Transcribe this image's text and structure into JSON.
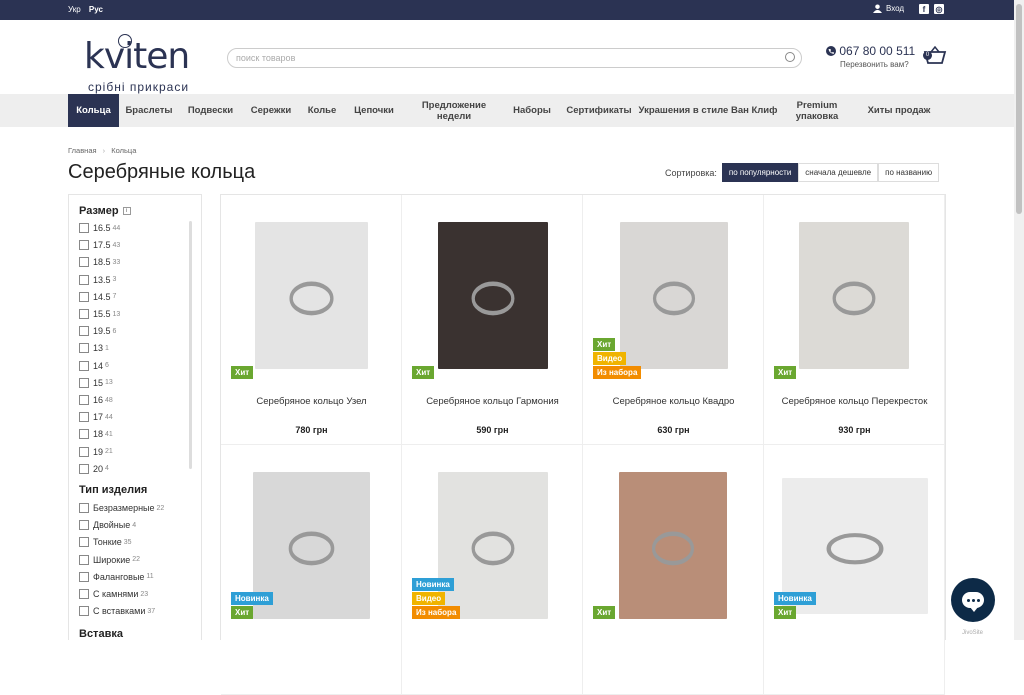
{
  "topbar": {
    "lang_ukr": "Укр",
    "lang_rus": "Рус",
    "login": "Вход",
    "social": [
      "facebook-icon",
      "instagram-icon"
    ]
  },
  "header": {
    "logo_word": "kviten",
    "logo_sub": "срібні прикраси",
    "search_placeholder": "поиск товаров",
    "phone": "067 80 00 511",
    "callback": "Перезвонить вам?",
    "cart_count": "0"
  },
  "nav": [
    {
      "label": "Кольца",
      "active": true
    },
    {
      "label": "Браслеты"
    },
    {
      "label": "Подвески"
    },
    {
      "label": "Сережки"
    },
    {
      "label": "Колье"
    },
    {
      "label": "Цепочки"
    },
    {
      "label": "Предложение недели"
    },
    {
      "label": "Наборы"
    },
    {
      "label": "Сертификаты"
    },
    {
      "label": "Украшения в стиле Ван Клиф"
    },
    {
      "label": "Premium упаковка"
    },
    {
      "label": "Хиты продаж"
    }
  ],
  "breadcrumb": {
    "home": "Главная",
    "current": "Кольца"
  },
  "page_title": "Серебряные кольца",
  "sort": {
    "label": "Сортировка:",
    "options": [
      "по популярности",
      "сначала дешевле",
      "по названию"
    ],
    "active": 0
  },
  "filters": {
    "size_title": "Размер",
    "sizes": [
      {
        "label": "16.5",
        "count": "44"
      },
      {
        "label": "17.5",
        "count": "43"
      },
      {
        "label": "18.5",
        "count": "33"
      },
      {
        "label": "13.5",
        "count": "3"
      },
      {
        "label": "14.5",
        "count": "7"
      },
      {
        "label": "15.5",
        "count": "13"
      },
      {
        "label": "19.5",
        "count": "6"
      },
      {
        "label": "13",
        "count": "1"
      },
      {
        "label": "14",
        "count": "6"
      },
      {
        "label": "15",
        "count": "13"
      },
      {
        "label": "16",
        "count": "48"
      },
      {
        "label": "17",
        "count": "44"
      },
      {
        "label": "18",
        "count": "41"
      },
      {
        "label": "19",
        "count": "21"
      },
      {
        "label": "20",
        "count": "4"
      }
    ],
    "type_title": "Тип изделия",
    "types": [
      {
        "label": "Безразмерные",
        "count": "22"
      },
      {
        "label": "Двойные",
        "count": "4"
      },
      {
        "label": "Тонкие",
        "count": "35"
      },
      {
        "label": "Широкие",
        "count": "22"
      },
      {
        "label": "Фаланговые",
        "count": "11"
      },
      {
        "label": "С камнями",
        "count": "23"
      },
      {
        "label": "С вставками",
        "count": "37"
      }
    ],
    "insert_title": "Вставка"
  },
  "products": [
    {
      "name": "Серебряное кольцо Узел",
      "price": "780 грн",
      "badges": [
        "Хит"
      ],
      "img": "#e4e4e4"
    },
    {
      "name": "Серебряное кольцо Гармония",
      "price": "590 грн",
      "badges": [
        "Хит"
      ],
      "img": "#3a3230"
    },
    {
      "name": "Серебряное кольцо Квадро",
      "price": "630 грн",
      "badges": [
        "Хит",
        "Видео",
        "Из набора"
      ],
      "img": "#d9d7d5"
    },
    {
      "name": "Серебряное кольцо Перекресток",
      "price": "930 грн",
      "badges": [
        "Хит"
      ],
      "img": "#dcdad6"
    },
    {
      "name": "",
      "price": "",
      "badges": [
        "Новинка",
        "Хит"
      ],
      "img": "#d8d8d8"
    },
    {
      "name": "",
      "price": "",
      "badges": [
        "Новинка",
        "Видео",
        "Из набора"
      ],
      "img": "#e2e2e0"
    },
    {
      "name": "",
      "price": "",
      "badges": [
        "Хит"
      ],
      "img": "#b98e78"
    },
    {
      "name": "",
      "price": "",
      "badges": [
        "Новинка",
        "Хит"
      ],
      "img": "#ececec"
    }
  ],
  "colors": {
    "brand": "#2b3353",
    "hit": "#6aa730",
    "video": "#f0b400",
    "set": "#f28c00",
    "new": "#2e9fd6"
  },
  "widget": {
    "jivo": "JivoSite"
  }
}
